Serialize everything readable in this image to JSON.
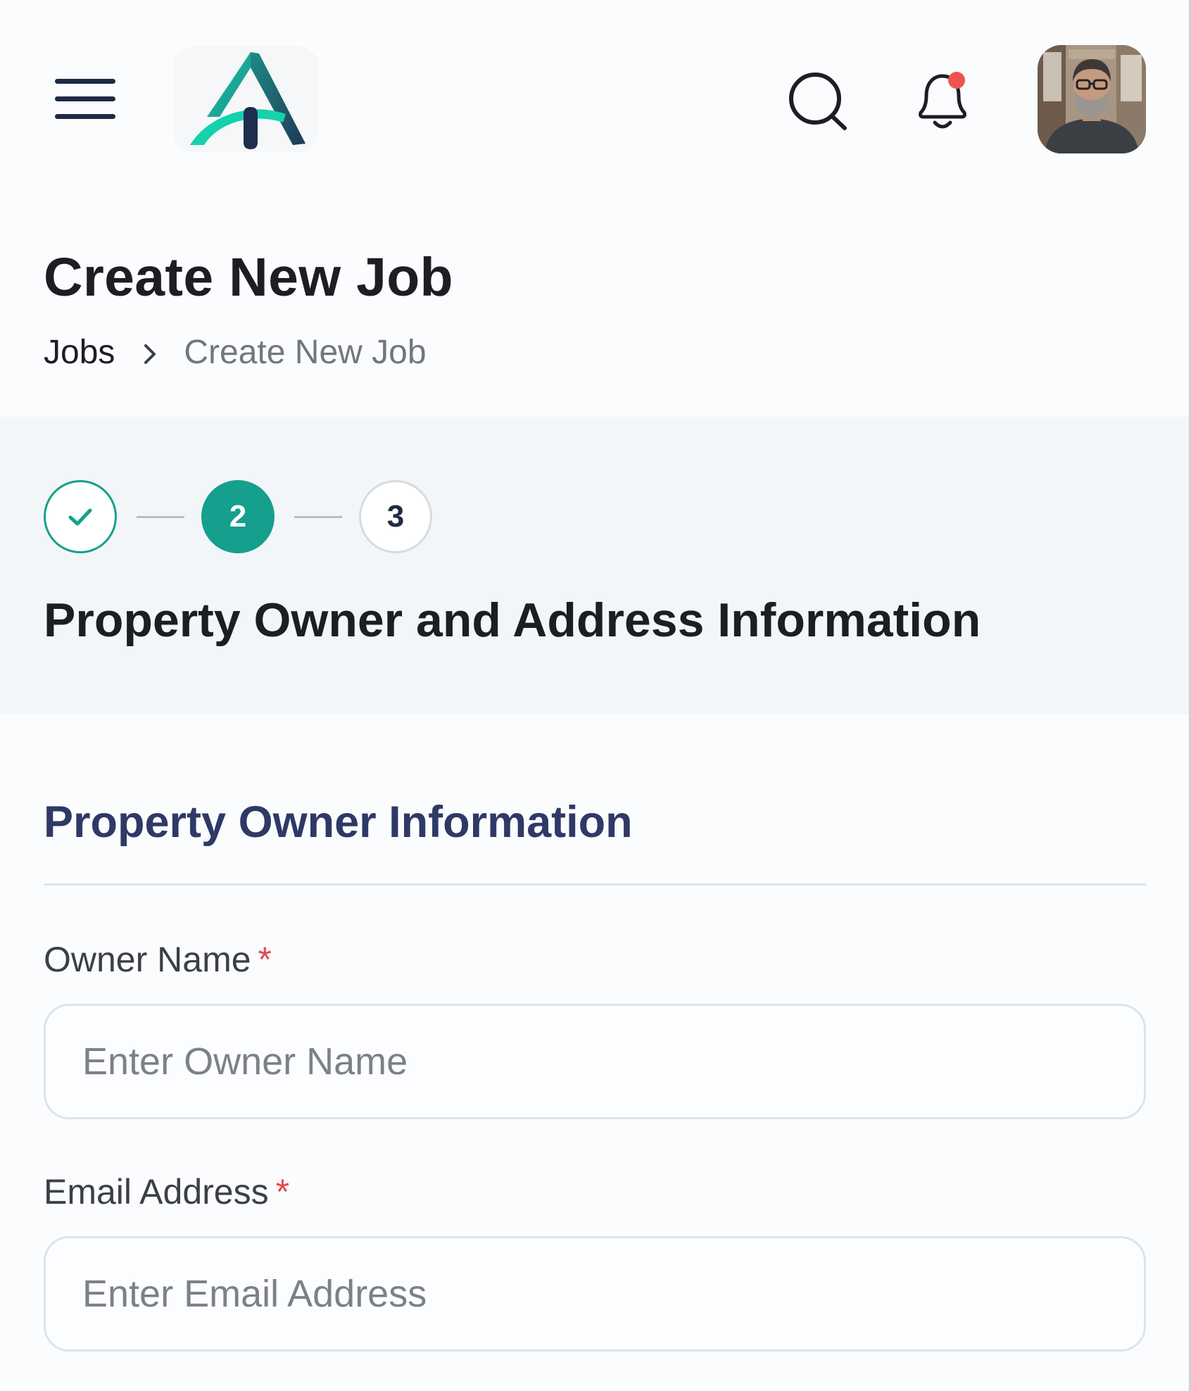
{
  "header": {
    "menu_icon": "hamburger-menu-icon",
    "logo_icon": "brand-logo-a",
    "search_icon": "search-icon",
    "bell_icon": "bell-icon",
    "notification_dot_color": "#f05252",
    "avatar_icon": "user-avatar"
  },
  "page": {
    "title": "Create New Job"
  },
  "breadcrumb": {
    "items": [
      {
        "label": "Jobs"
      },
      {
        "label": "Create New Job"
      }
    ],
    "separator_icon": "chevron-right-icon"
  },
  "stepper": {
    "steps": [
      {
        "number": "1",
        "state": "completed",
        "icon": "check-icon"
      },
      {
        "number": "2",
        "state": "active"
      },
      {
        "number": "3",
        "state": "pending"
      }
    ],
    "current_step_title": "Property Owner and Address Information",
    "accent_color": "#14a08c"
  },
  "form": {
    "section_title": "Property Owner Information",
    "fields": [
      {
        "label": "Owner Name",
        "required_mark": "*",
        "value": "",
        "placeholder": "Enter Owner Name"
      },
      {
        "label": "Email Address",
        "required_mark": "*",
        "value": "",
        "placeholder": "Enter Email Address"
      }
    ]
  }
}
